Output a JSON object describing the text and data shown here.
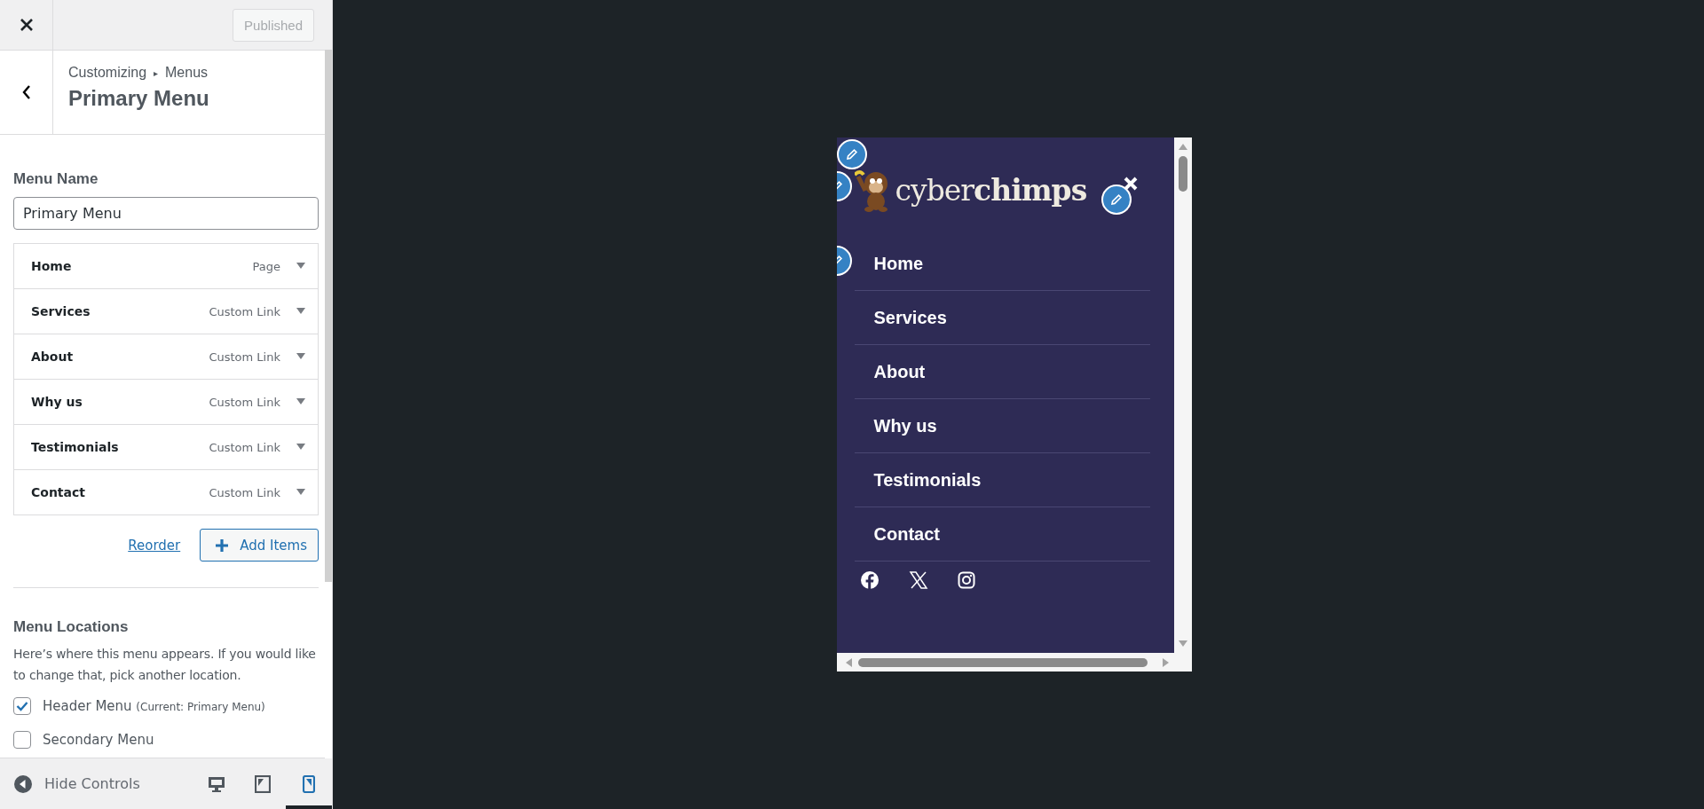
{
  "header": {
    "publish_button": {
      "label": "Published",
      "disabled": true
    }
  },
  "section": {
    "breadcrumb": [
      "Customizing",
      "Menus"
    ],
    "separator": "▸",
    "title": "Primary Menu"
  },
  "menu_name": {
    "label": "Menu Name",
    "value": "Primary Menu"
  },
  "menu_items": [
    {
      "title": "Home",
      "type": "Page"
    },
    {
      "title": "Services",
      "type": "Custom Link"
    },
    {
      "title": "About",
      "type": "Custom Link"
    },
    {
      "title": "Why us",
      "type": "Custom Link"
    },
    {
      "title": "Testimonials",
      "type": "Custom Link"
    },
    {
      "title": "Contact",
      "type": "Custom Link"
    }
  ],
  "actions": {
    "reorder": "Reorder",
    "add_items": "Add Items"
  },
  "locations": {
    "heading": "Menu Locations",
    "description": "Here’s where this menu appears. If you would like to change that, pick another location.",
    "options": [
      {
        "label": "Header Menu",
        "note": "(Current: Primary Menu)",
        "checked": true
      },
      {
        "label": "Secondary Menu",
        "checked": false
      }
    ]
  },
  "footer": {
    "hide_controls": "Hide Controls",
    "devices": [
      {
        "kind": "desktop",
        "selected": false
      },
      {
        "kind": "tablet",
        "selected": false
      },
      {
        "kind": "mobile",
        "selected": true
      }
    ]
  },
  "preview": {
    "logo": "cyber**chimps**",
    "nav": [
      "Home",
      "Services",
      "About",
      "Why us",
      "Testimonials",
      "Contact"
    ],
    "social": [
      {
        "kind": "facebook"
      },
      {
        "kind": "x"
      },
      {
        "kind": "instagram"
      }
    ]
  }
}
